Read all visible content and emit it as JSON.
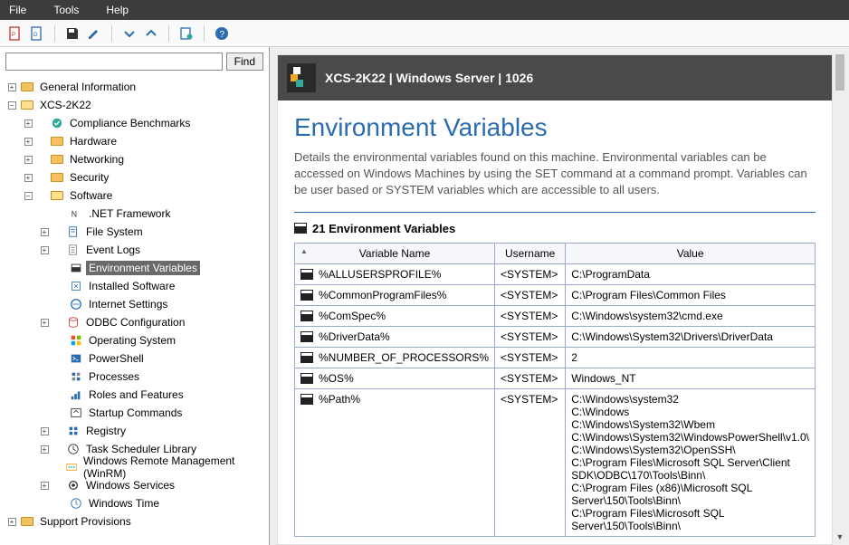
{
  "menu": {
    "file": "File",
    "tools": "Tools",
    "help": "Help"
  },
  "search": {
    "find": "Find",
    "value": ""
  },
  "tree": {
    "general": "General Information",
    "host": "XCS-2K22",
    "compliance": "Compliance Benchmarks",
    "hardware": "Hardware",
    "networking": "Networking",
    "security": "Security",
    "software": "Software",
    "sw": {
      "net": ".NET Framework",
      "fs": "File System",
      "ev": "Event Logs",
      "env": "Environment Variables",
      "inst": "Installed Software",
      "ie": "Internet Settings",
      "odbc": "ODBC Configuration",
      "os": "Operating System",
      "ps": "PowerShell",
      "proc": "Processes",
      "roles": "Roles and Features",
      "startup": "Startup Commands",
      "reg": "Registry",
      "task": "Task Scheduler Library",
      "winrm": "Windows Remote Management (WinRM)",
      "svc": "Windows Services",
      "time": "Windows Time"
    },
    "support": "Support Provisions"
  },
  "panel": {
    "header": "XCS-2K22 | Windows Server | 1026",
    "title": "Environment Variables",
    "desc": "Details the environmental variables found on this machine. Environmental variables can be accessed on Windows Machines by using the SET command at a command prompt. Variables can be user based or SYSTEM variables which are accessible to all users.",
    "count_label": "21 Environment Variables",
    "cols": {
      "name": "Variable Name",
      "user": "Username",
      "val": "Value"
    },
    "rows": [
      {
        "name": "%ALLUSERSPROFILE%",
        "user": "<SYSTEM>",
        "val": "C:\\ProgramData"
      },
      {
        "name": "%CommonProgramFiles%",
        "user": "<SYSTEM>",
        "val": "C:\\Program Files\\Common Files"
      },
      {
        "name": "%ComSpec%",
        "user": "<SYSTEM>",
        "val": "C:\\Windows\\system32\\cmd.exe"
      },
      {
        "name": "%DriverData%",
        "user": "<SYSTEM>",
        "val": "C:\\Windows\\System32\\Drivers\\DriverData"
      },
      {
        "name": "%NUMBER_OF_PROCESSORS%",
        "user": "<SYSTEM>",
        "val": "2"
      },
      {
        "name": "%OS%",
        "user": "<SYSTEM>",
        "val": "Windows_NT"
      },
      {
        "name": "%Path%",
        "user": "<SYSTEM>",
        "val": "C:\\Windows\\system32\nC:\\Windows\nC:\\Windows\\System32\\Wbem\nC:\\Windows\\System32\\WindowsPowerShell\\v1.0\\\nC:\\Windows\\System32\\OpenSSH\\\nC:\\Program Files\\Microsoft SQL Server\\Client SDK\\ODBC\\170\\Tools\\Binn\\\nC:\\Program Files (x86)\\Microsoft SQL Server\\150\\Tools\\Binn\\\nC:\\Program Files\\Microsoft SQL Server\\150\\Tools\\Binn\\"
      }
    ]
  }
}
